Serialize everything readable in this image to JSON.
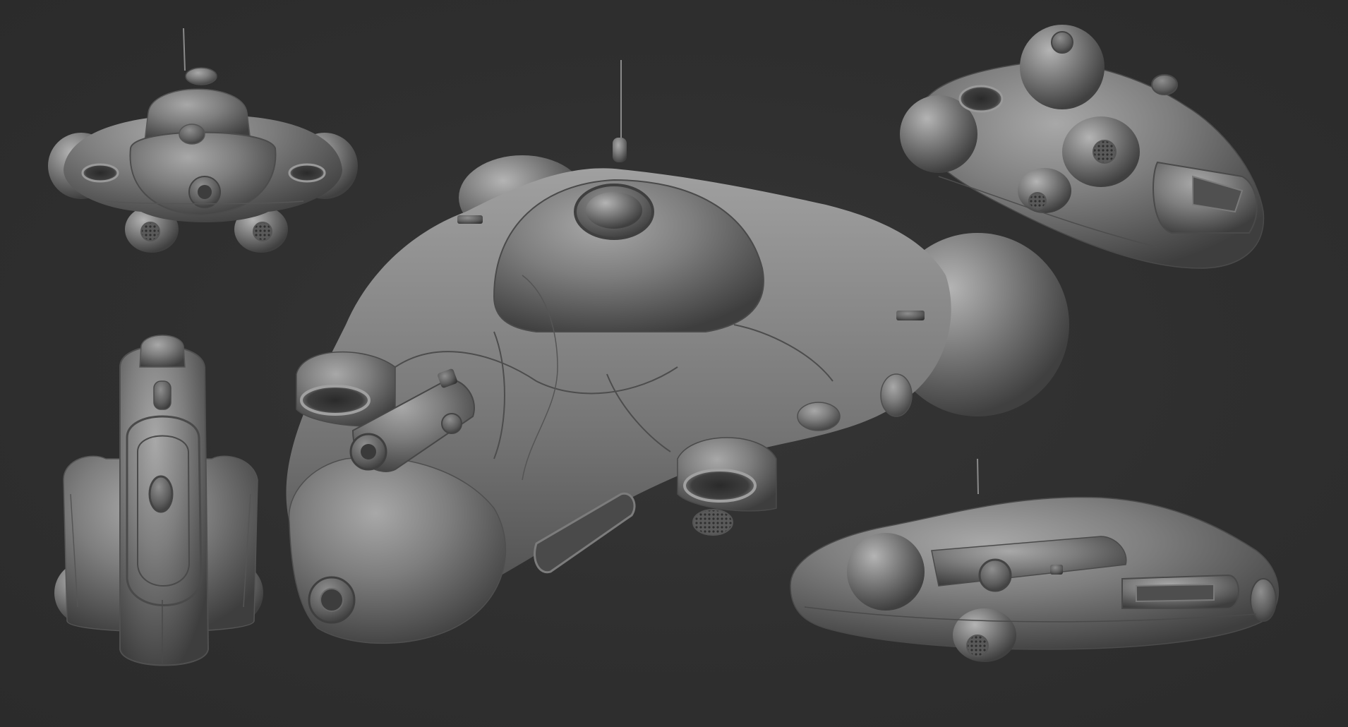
{
  "scene": {
    "background_color": "#2f2f2f",
    "clay_color": "#8a8a8a",
    "views": [
      {
        "name": "front-view",
        "description_kind": "render"
      },
      {
        "name": "top-view",
        "description_kind": "render"
      },
      {
        "name": "perspective-main-view",
        "description_kind": "render"
      },
      {
        "name": "rear-three-quarter-view",
        "description_kind": "render"
      },
      {
        "name": "side-view",
        "description_kind": "render"
      }
    ]
  }
}
